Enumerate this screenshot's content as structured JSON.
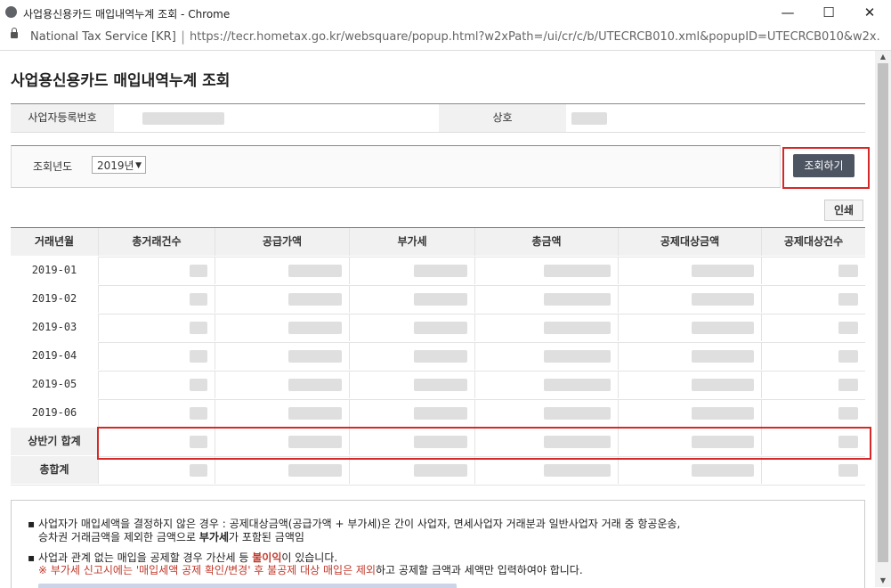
{
  "window": {
    "title": "사업용신용카드 매입내역누계 조회 - Chrome",
    "controls": {
      "minimize": "—",
      "maximize": "☐",
      "close": "✕"
    }
  },
  "addressbar": {
    "site": "National Tax Service [KR]",
    "separator": "|",
    "url": "https://tecr.hometax.go.kr/websquare/popup.html?w2xPath=/ui/cr/c/b/UTECRCB010.xml&popupID=UTECRCB010&w2x..."
  },
  "page": {
    "title": "사업용신용카드 매입내역누계 조회"
  },
  "info": {
    "bizno_label": "사업자등록번호",
    "company_label": "상호"
  },
  "search": {
    "year_label": "조회년도",
    "year_value": "2019년",
    "search_button": "조회하기"
  },
  "print_button": "인쇄",
  "table": {
    "headers": [
      "거래년월",
      "총거래건수",
      "공급가액",
      "부가세",
      "총금액",
      "공제대상금액",
      "공제대상건수"
    ],
    "months": [
      "2019-01",
      "2019-02",
      "2019-03",
      "2019-04",
      "2019-05",
      "2019-06"
    ],
    "half_total_label": "상반기 합계",
    "grand_total_label": "총합계"
  },
  "notes": {
    "n1_prefix": "사업자가 매입세액을 결정하지 않은 경우 : 공제대상금액(공급가액 + 부가세)은 간이 사업자, 면세사업자 거래분과 일반사업자 거래 중 항공운송,",
    "n1_line2_a": "승차권 거래금액을 제외한 금액으로 ",
    "n1_line2_bold": "부가세",
    "n1_line2_b": "가 포함된 금액임",
    "n2_a": "사업과 관계 없는 매입을 공제할 경우 가산세 등 ",
    "n2_bold": "불이익",
    "n2_b": "이 있습니다.",
    "n3_a": "※ 부가세 신고시에는 '매입세액 공제 확인/변경' 후 불공제 대상 매입은 제외",
    "n3_b": "하고 공제할 금액과 세액만 입력하여야 합니다."
  },
  "colors": {
    "highlight": "#d62828",
    "button_dark": "#4d5462",
    "header_bg": "#f1f1f1"
  }
}
